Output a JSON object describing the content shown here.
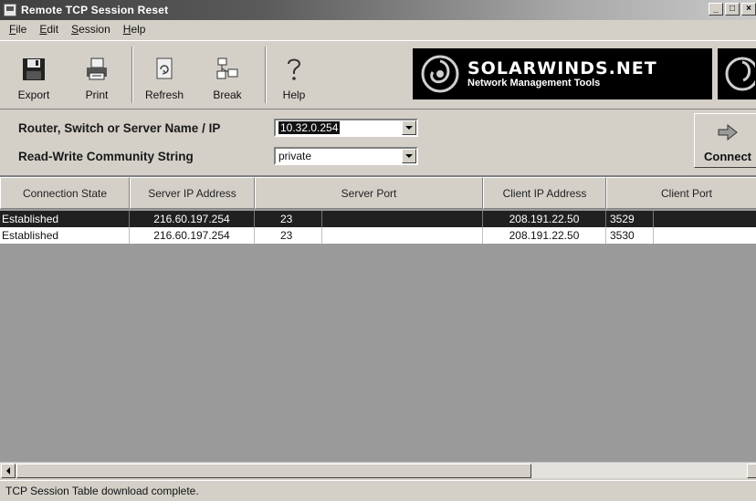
{
  "window": {
    "title": "Remote TCP Session Reset",
    "controls": [
      "_",
      "□",
      "×"
    ]
  },
  "menu": [
    {
      "label": "File",
      "accel": "F",
      "rest": "ile"
    },
    {
      "label": "Edit",
      "accel": "E",
      "rest": "dit"
    },
    {
      "label": "Session",
      "accel": "S",
      "rest": "ession"
    },
    {
      "label": "Help",
      "accel": "H",
      "rest": "elp"
    }
  ],
  "toolbar": {
    "export_label": "Export",
    "print_label": "Print",
    "refresh_label": "Refresh",
    "break_label": "Break",
    "help_label": "Help",
    "icons": {
      "export": "floppy-disk-icon",
      "print": "printer-icon",
      "refresh": "refresh-icon",
      "break": "network-break-icon",
      "help": "question-mark-icon"
    }
  },
  "banner": {
    "brand": "SOLARWINDS.NET",
    "tagline": "Network Management Tools"
  },
  "form": {
    "device_label": "Router, Switch or Server Name / IP",
    "device_value": "10.32.0.254",
    "community_label": "Read-Write Community String",
    "community_value": "private",
    "connect_label": "Connect"
  },
  "table": {
    "columns": [
      "Connection State",
      "Server IP Address",
      "Server Port",
      "Client IP Address",
      "Client Port"
    ],
    "rows": [
      {
        "state": "Established",
        "server_ip": "216.60.197.254",
        "server_port": "23",
        "client_ip": "208.191.22.50",
        "client_port": "3529",
        "selected": true
      },
      {
        "state": "Established",
        "server_ip": "216.60.197.254",
        "server_port": "23",
        "client_ip": "208.191.22.50",
        "client_port": "3530",
        "selected": false
      }
    ]
  },
  "status": {
    "text": "TCP Session Table download complete."
  }
}
